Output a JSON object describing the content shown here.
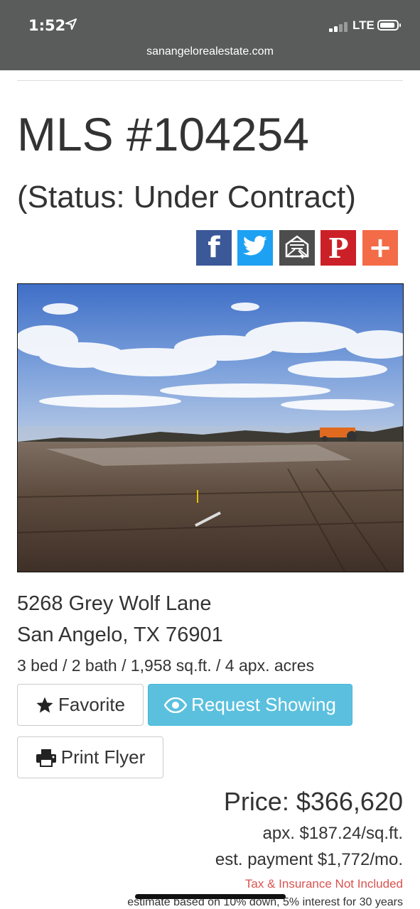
{
  "status_bar": {
    "time": "1:52",
    "network": "LTE",
    "url": "sanangelorealestate.com"
  },
  "listing": {
    "mls_title": "MLS #104254",
    "status": "(Status: Under Contract)",
    "address_line1": "5268 Grey Wolf Lane",
    "address_line2": "San Angelo, TX 76901",
    "details": "3 bed / 2 bath / 1,958 sq.ft. / 4 apx. acres"
  },
  "share": {
    "facebook_glyph": "f",
    "pinterest_glyph": "P",
    "plus_glyph": "+",
    "colors": {
      "facebook": "#3b5998",
      "twitter": "#1da1f2",
      "email": "#4d4d4d",
      "pinterest": "#cb2027",
      "plus": "#f46b48"
    },
    "icons": [
      "facebook-icon",
      "twitter-icon",
      "email-icon",
      "pinterest-icon",
      "plus-icon"
    ]
  },
  "actions": {
    "favorite_label": "Favorite",
    "request_label": "Request Showing",
    "print_label": "Print Flyer",
    "request_color": "#5bc0de"
  },
  "pricing": {
    "price": "Price: $366,620",
    "per_sqft": "apx. $187.24/sq.ft.",
    "payment": "est. payment $1,772/mo.",
    "tax_note": "Tax & Insurance Not Included",
    "estimate_note": "estimate based on 10% down, 5% interest for 30 years",
    "tax_note_color": "#d9534f"
  }
}
